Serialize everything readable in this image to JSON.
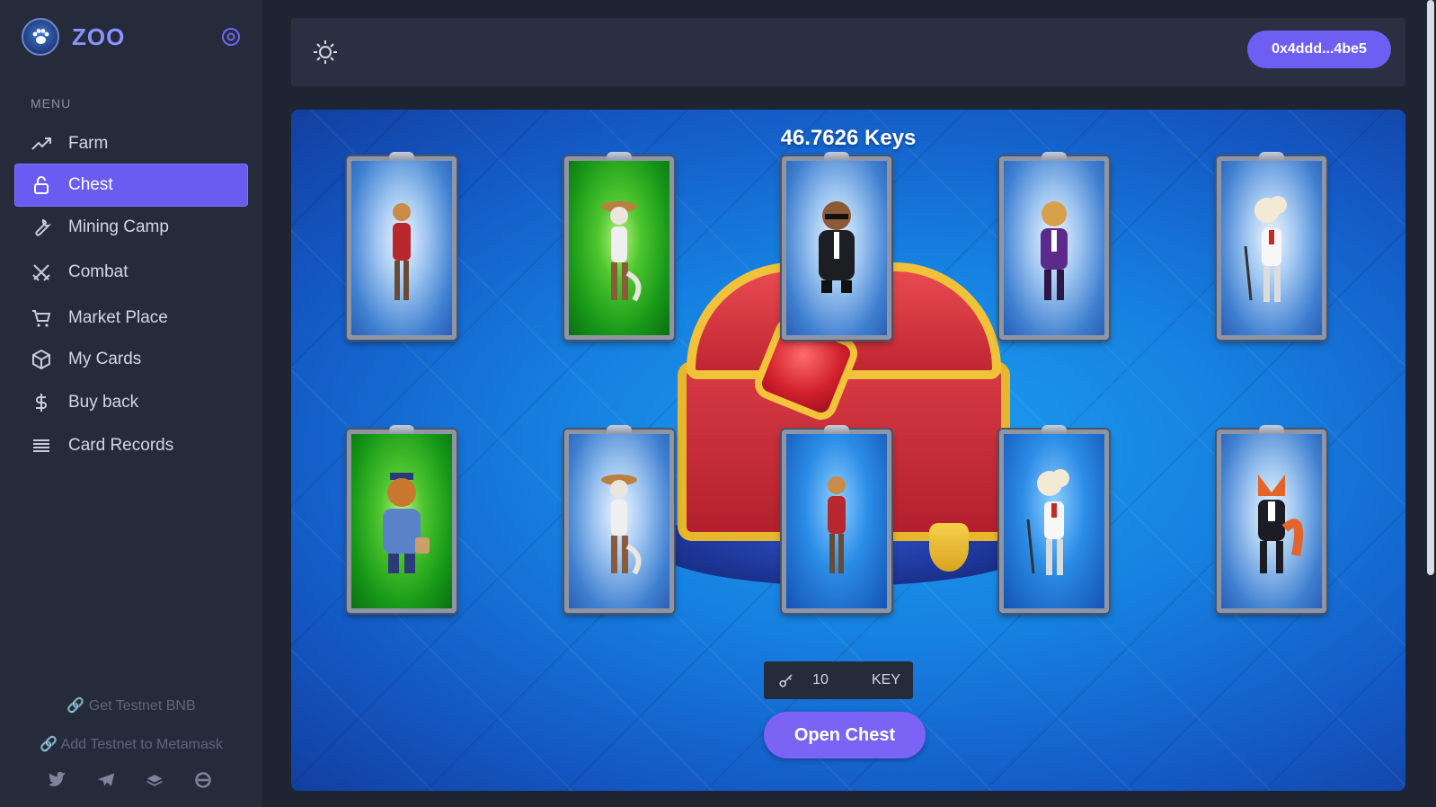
{
  "brand": {
    "name": "ZOO"
  },
  "menu": {
    "heading": "MENU",
    "items": [
      {
        "label": "Farm",
        "icon": "trend-up-icon",
        "active": false
      },
      {
        "label": "Chest",
        "icon": "lock-icon",
        "active": true
      },
      {
        "label": "Mining Camp",
        "icon": "wrench-icon",
        "active": false
      },
      {
        "label": "Combat",
        "icon": "crossed-swords-icon",
        "active": false
      },
      {
        "label": "Market Place",
        "icon": "cart-icon",
        "active": false
      },
      {
        "label": "My Cards",
        "icon": "box-icon",
        "active": false
      },
      {
        "label": "Buy back",
        "icon": "dollar-icon",
        "active": false
      },
      {
        "label": "Card Records",
        "icon": "list-icon",
        "active": false
      }
    ]
  },
  "links": {
    "testnet_bnb": "🔗 Get Testnet BNB",
    "add_testnet": "🔗 Add Testnet to Metamask"
  },
  "socials": [
    "twitter-icon",
    "telegram-icon",
    "gitbook-icon",
    "medium-icon"
  ],
  "header": {
    "wallet": "0x4ddd...4be5"
  },
  "chest": {
    "keys_title": "46.7626 Keys",
    "key_amount": "10",
    "key_unit": "KEY",
    "open_button": "Open Chest"
  },
  "cards": [
    {
      "rarity": "common",
      "character": "camel-card"
    },
    {
      "rarity": "rare",
      "character": "cowboy-cat-card"
    },
    {
      "rarity": "common",
      "character": "bear-agent-card"
    },
    {
      "rarity": "common",
      "character": "lion-tux-card"
    },
    {
      "rarity": "common",
      "character": "poodle-conductor-card"
    },
    {
      "rarity": "rare",
      "character": "police-lion-card"
    },
    {
      "rarity": "common",
      "character": "cowboy-cat-card"
    },
    {
      "rarity": "epic",
      "character": "camel-card"
    },
    {
      "rarity": "epic",
      "character": "poodle-conductor-card"
    },
    {
      "rarity": "common",
      "character": "fox-tux-card"
    }
  ],
  "colors": {
    "accent": "#6e5ff3",
    "sidebar_bg": "#262b3c",
    "page_bg": "#1f2433",
    "brand_text": "#8a93ff"
  }
}
